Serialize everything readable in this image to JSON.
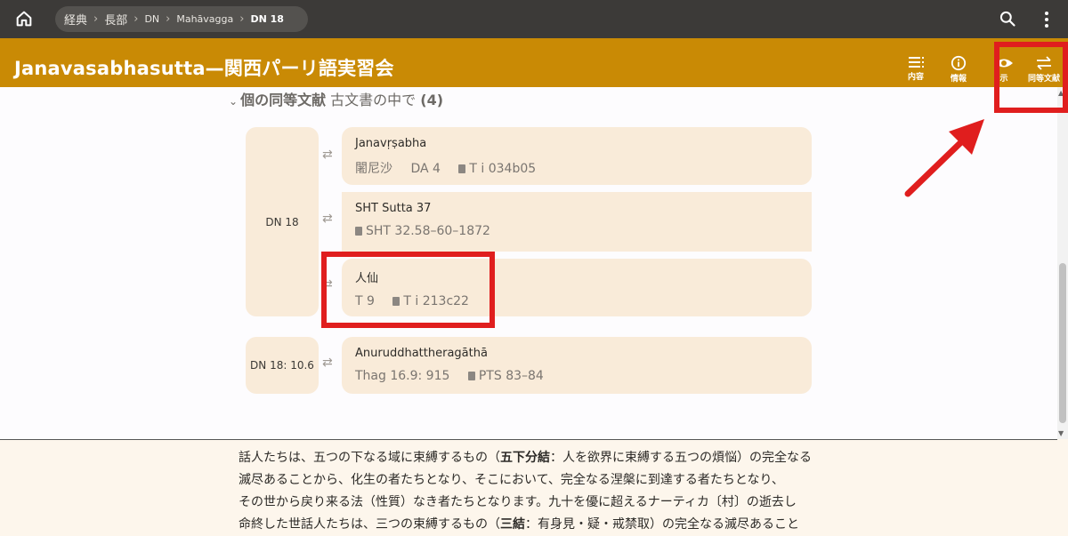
{
  "breadcrumb": [
    "経典",
    "長部",
    "DN",
    "Mahāvagga",
    "DN 18"
  ],
  "title": "Janavasabhasutta—関西パーリ語実習会",
  "toolbar": {
    "contents_label": "内容",
    "info_label": "情報",
    "view_label": "示",
    "parallels_label": "同等文献"
  },
  "section": {
    "title": "個の同等文献",
    "subtitle": "古文書の中で",
    "count": "(4)"
  },
  "groups": [
    {
      "source": "DN 18",
      "parallels": [
        {
          "name": "Janavṛṣabha",
          "refs": [
            "闍尼沙",
            "DA 4"
          ],
          "book": "T i 034b05"
        },
        {
          "name": "SHT Sutta 37",
          "refs": [],
          "book": "SHT 32.58–60–1872"
        },
        {
          "name": "人仙",
          "refs": [
            "T 9"
          ],
          "book": "T i 213c22"
        }
      ]
    },
    {
      "source": "DN 18: 10.6",
      "parallels": [
        {
          "name": "Anuruddhattheragāthā",
          "refs": [
            "Thag 16.9: 915"
          ],
          "book": "PTS 83–84"
        }
      ]
    }
  ],
  "body": {
    "line1_a": "話人たちは、五つの下なる域に束縛するもの（",
    "line1_b": "五下分結",
    "line1_c": "：人を欲界に束縛する五つの煩悩）の完全なる",
    "line2": "滅尽あることから、化生の者たちとなり、そこにおいて、完全なる涅槃に到達する者たちとなり、",
    "line3": "その世から戻り来る法（性質）なき者たちとなります。九十を優に超えるナーティカ〔村〕の逝去し",
    "line4_a": "命終した世話人たちは、三つの束縛するもの（",
    "line4_b": "三結",
    "line4_c": "：有身見・疑・戒禁取）の完全なる滅尽あること"
  },
  "colors": {
    "topbar": "#3c3a38",
    "titlebar": "#c98a05",
    "card": "#f9ebd9",
    "highlight": "#e01e1e"
  }
}
